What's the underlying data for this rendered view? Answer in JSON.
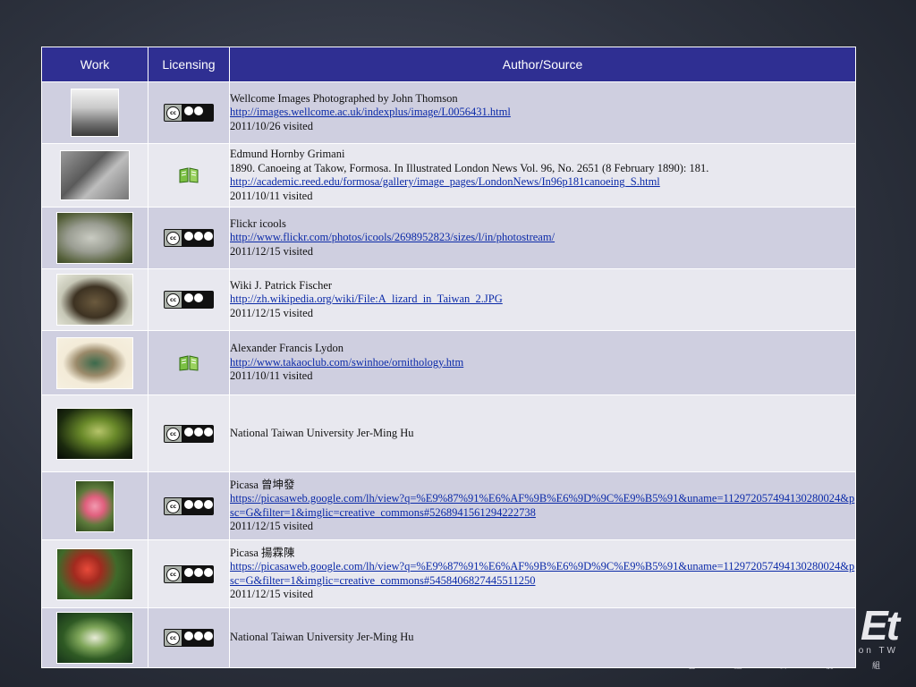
{
  "header": {
    "work": "Work",
    "licensing": "Licensing",
    "source": "Author/Source"
  },
  "rows": [
    {
      "license": "cc-by-nc-icon",
      "lines": [
        {
          "t": "text",
          "v": "Wellcome Images Photographed by John Thomson"
        },
        {
          "t": "link",
          "v": "http://images.wellcome.ac.uk/indexplus/image/L0056431.html"
        },
        {
          "t": "text",
          "v": "2011/10/26 visited"
        }
      ]
    },
    {
      "license": "public-domain-book-icon",
      "lines": [
        {
          "t": "text",
          "v": "Edmund Hornby Grimani"
        },
        {
          "t": "text",
          "v": "1890. Canoeing at Takow, Formosa. In Illustrated London News Vol. 96, No. 2651 (8 February 1890): 181."
        },
        {
          "t": "link",
          "v": "http://academic.reed.edu/formosa/gallery/image_pages/LondonNews/In96p181canoeing_S.html"
        },
        {
          "t": "text",
          "v": "2011/10/11 visited"
        }
      ]
    },
    {
      "license": "cc-by-nc-nd-icon",
      "lines": [
        {
          "t": "text",
          "v": "Flickr icools"
        },
        {
          "t": "link",
          "v": "http://www.flickr.com/photos/icools/2698952823/sizes/l/in/photostream/"
        },
        {
          "t": "text",
          "v": "2011/12/15 visited"
        }
      ]
    },
    {
      "license": "cc-by-sa-icon",
      "lines": [
        {
          "t": "text",
          "v": "Wiki J. Patrick Fischer"
        },
        {
          "t": "link",
          "v": "http://zh.wikipedia.org/wiki/File:A_lizard_in_Taiwan_2.JPG"
        },
        {
          "t": "text",
          "v": "2011/12/15 visited"
        }
      ]
    },
    {
      "license": "public-domain-book-icon",
      "lines": [
        {
          "t": "text",
          "v": "Alexander Francis Lydon"
        },
        {
          "t": "link",
          "v": "http://www.takaoclub.com/swinhoe/ornithology.htm"
        },
        {
          "t": "text",
          "v": "2011/10/11 visited"
        }
      ]
    },
    {
      "license": "cc-by-nc-sa-icon",
      "lines": [
        {
          "t": "text",
          "v": "National Taiwan University Jer-Ming Hu"
        }
      ]
    },
    {
      "license": "cc-by-nc-sa-icon",
      "lines": [
        {
          "t": "text",
          "v": "Picasa 曾坤發"
        },
        {
          "t": "link",
          "v": "https://picasaweb.google.com/lh/view?q=%E9%87%91%E6%AF%9B%E6%9D%9C%E9%B5%91&uname=112972057494130280024&psc=G&filter=1&imglic=creative_commons#5268941561294222738"
        },
        {
          "t": "text",
          "v": "2011/12/15 visited"
        }
      ]
    },
    {
      "license": "cc-by-nc-sa-icon",
      "lines": [
        {
          "t": "text",
          "v": "Picasa 揚霖陳"
        },
        {
          "t": "link",
          "v": "https://picasaweb.google.com/lh/view?q=%E9%87%91%E6%AF%9B%E6%9D%9C%E9%B5%91&uname=112972057494130280024&psc=G&filter=1&imglic=creative_commons#5458406827445511250"
        },
        {
          "t": "text",
          "v": "2011/12/15 visited"
        }
      ]
    },
    {
      "license": "cc-by-nc-sa-icon",
      "lines": [
        {
          "t": "text",
          "v": "National Taiwan University Jer-Ming Hu"
        }
      ]
    }
  ],
  "thumbnails": [
    "landscape-photo-thumbnail",
    "forest-engraving-thumbnail",
    "stone-lion-thumbnail",
    "lizard-thumbnail",
    "bird-illustration-thumbnail",
    "leaf-plant-thumbnail",
    "pink-flower-thumbnail",
    "red-flowers-thumbnail",
    "green-plant-thumbnail"
  ]
}
